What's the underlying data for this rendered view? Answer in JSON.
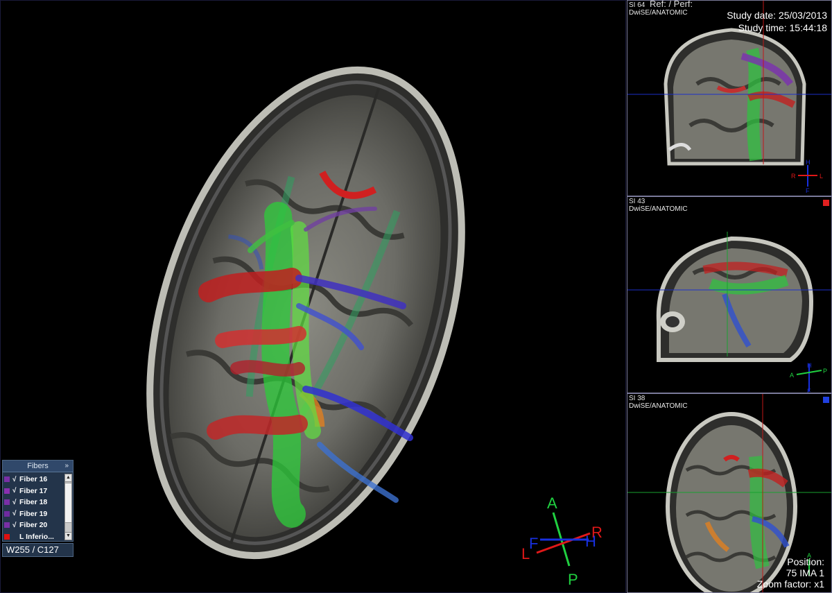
{
  "main": {
    "orientation": {
      "anterior": "A",
      "posterior": "P",
      "right": "R",
      "left": "L",
      "foot": "F",
      "head": "H"
    }
  },
  "fibers_panel": {
    "title": "Fibers",
    "more": "»",
    "items": [
      {
        "label": "Fiber 16",
        "check": "√",
        "color": "#7a2fa6"
      },
      {
        "label": "Fiber 17",
        "check": "√",
        "color": "#8a2fb0"
      },
      {
        "label": "Fiber 18",
        "check": "√",
        "color": "#7a2fa6"
      },
      {
        "label": "Fiber 19",
        "check": "√",
        "color": "#6f2aa0"
      },
      {
        "label": "Fiber 20",
        "check": "√",
        "color": "#7a2fa6"
      },
      {
        "label": "L Inferio...",
        "check": "",
        "color": "#e01010"
      }
    ]
  },
  "window_level": "W255 / C127",
  "panels": {
    "coronal": {
      "series": "SI 64",
      "sequence": "DwiSE/ANATOMIC",
      "ref": "Ref:  / Perf:",
      "study_date": "Study date: 25/03/2013",
      "study_time": "Study time: 15:44:18",
      "orientation": {
        "head": "H",
        "foot": "F",
        "right": "R",
        "left": "L"
      }
    },
    "sagittal": {
      "series": "SI 43",
      "sequence": "DwiSE/ANATOMIC",
      "marker_color": "#e02020",
      "orientation": {
        "anterior": "A",
        "posterior": "P",
        "head": "H",
        "foot": "F"
      }
    },
    "axial": {
      "series": "SI 38",
      "sequence": "DwiSE/ANATOMIC",
      "marker_color": "#2040e0",
      "position_label": "Position:",
      "position_value": "75 IMA 1",
      "zoom": "Zoom factor: x1",
      "orientation": {
        "anterior": "A"
      }
    }
  },
  "colors": {
    "axis_green": "#20d040",
    "axis_red": "#e01818",
    "axis_blue": "#1830e0",
    "crosshair_blue": "#1c30c8",
    "crosshair_red": "#c01818",
    "crosshair_green": "#18a030"
  }
}
